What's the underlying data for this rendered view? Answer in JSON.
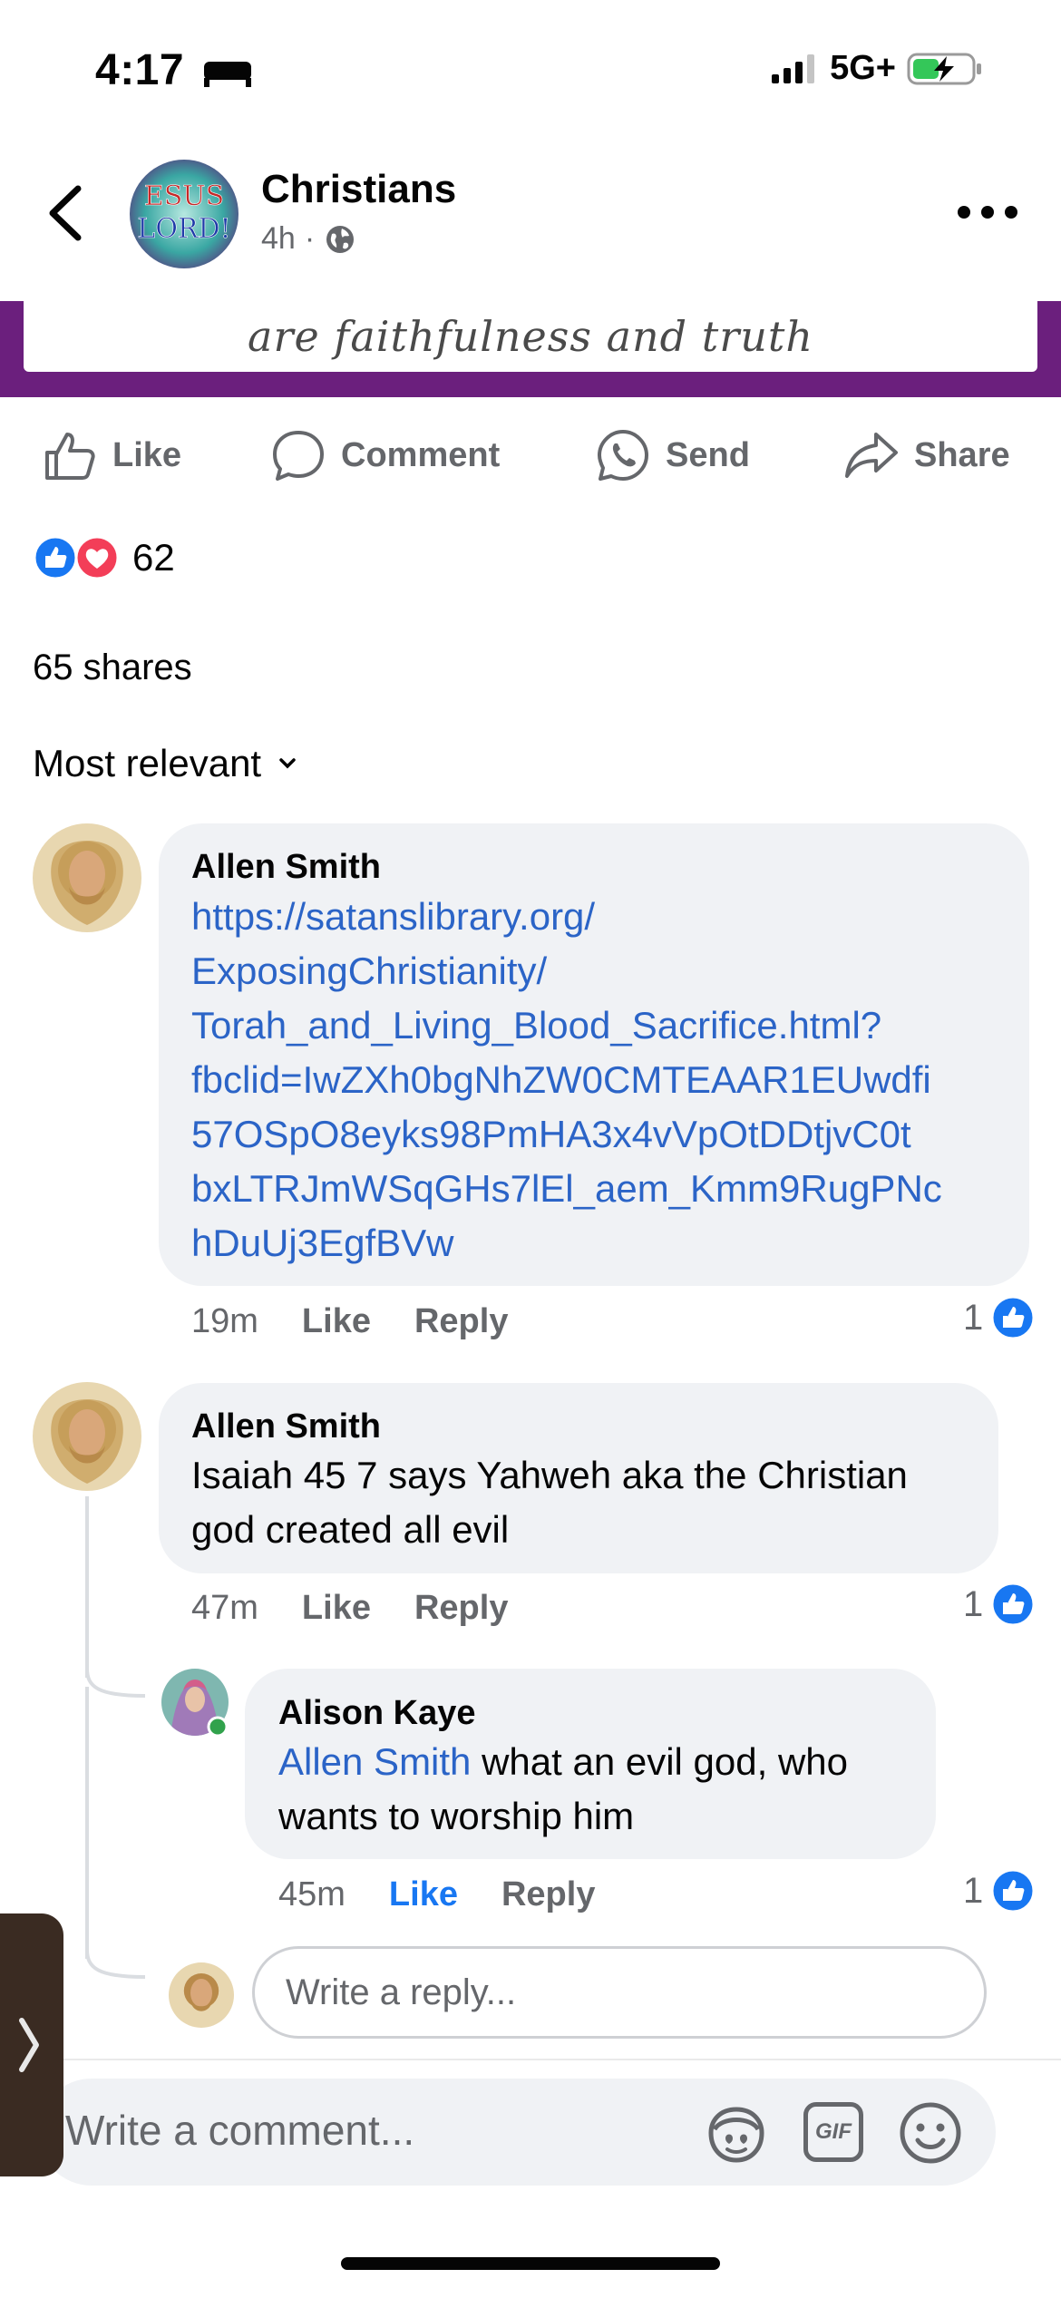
{
  "status_bar": {
    "time": "4:17",
    "network": "5G+"
  },
  "header": {
    "group_name": "Christians",
    "time_ago": "4h",
    "separator": "·",
    "avatar_text_line1": "ESUS",
    "avatar_text_line2": "LORD!"
  },
  "post_image": {
    "caption": "are faithfulness and truth"
  },
  "actions": {
    "like": "Like",
    "comment": "Comment",
    "send": "Send",
    "share": "Share"
  },
  "reactions": {
    "count": "62"
  },
  "shares": "65 shares",
  "sort": {
    "label": "Most relevant"
  },
  "comments": [
    {
      "author": "Allen Smith",
      "lines": [
        "https://satanslibrary.org/",
        "ExposingChristianity/",
        "Torah_and_Living_Blood_Sacrifice.html?",
        "fbclid=IwZXh0bgNhZW0CMTEAAR1EUwdfi",
        "57OSpO8eyks98PmHA3x4vVpOtDDtjvC0t",
        "bxLTRJmWSqGHs7lEl_aem_Kmm9RugPNc",
        "hDuUj3EgfBVw"
      ],
      "time": "19m",
      "like": "Like",
      "reply": "Reply",
      "like_count": "1"
    },
    {
      "author": "Allen Smith",
      "lines": [
        "Isaiah 45 7 says Yahweh aka the Christian",
        "god created all evil"
      ],
      "time": "47m",
      "like": "Like",
      "reply": "Reply",
      "like_count": "1"
    }
  ],
  "reply": {
    "author": "Alison Kaye",
    "mention": "Allen Smith",
    "line1_rest": " what an evil god, who",
    "line2": "wants to worship him",
    "time": "45m",
    "like": "Like",
    "reply": "Reply",
    "like_count": "1"
  },
  "write_reply_placeholder": "Write a reply...",
  "composer": {
    "placeholder": "Write a comment...",
    "gif_label": "GIF"
  },
  "colors": {
    "brand_blue": "#1877f2",
    "link": "#2b64c7",
    "bubble": "#f0f2f5",
    "image_band": "#6b1f7d"
  }
}
